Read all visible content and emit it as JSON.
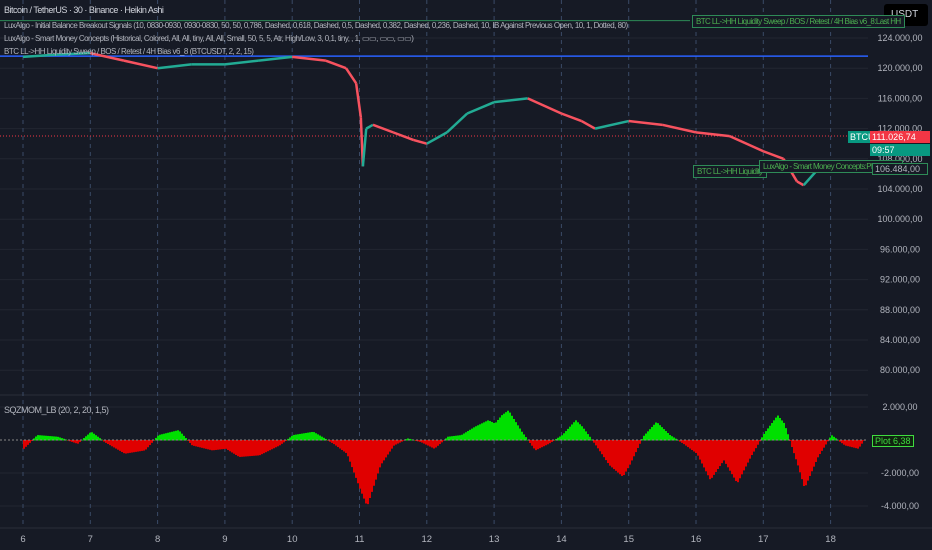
{
  "header": {
    "title": "Bitcoin / TetherUS · 30 · Binance · Heikin Ashi",
    "currency": "USDT"
  },
  "indicators": [
    "LuxAlgo - Initial Balance Breakout Signals (10, 0830-0930, 0930-0830, 50, 50, 0,786, Dashed, 0,618, Dashed, 0,5, Dashed, 0,382, Dashed, 0,236, Dashed, 10, IB Against Previous Open, 10, 1, Dotted, 80)",
    "LuxAlgo - Smart Money Concepts (Historical, Colored, All, All, tiny, All, All, Small, 50, 5, 5, Atr, High/Low, 3, 0,1, tiny, , 1, ▭▭, ▭▭, ▭▭)",
    "BTC LL->HH Liquidity Sweep / BOS / Retest / 4H Bias v6_8 (BTCUSDT, 2, 2, 15)"
  ],
  "oscillator": {
    "label": "SQZMOM_LB (20, 2, 20, 1,5)",
    "plot_label": "Plot",
    "plot_value": "6,38"
  },
  "tags": {
    "last_hh": "BTC LL->HH Liquidity Sweep / BOS / Retest / 4H Bias v6_8:Last HH",
    "ll_hh": "BTC LL->HH Liquidity",
    "plotcandle": "LuxAlgo - Smart Money Concepts:PlotCandle"
  },
  "price_box": {
    "ticker": "BTCU",
    "price": "111.026,74",
    "countdown": "09:57",
    "level": "106.484,00"
  },
  "colors": {
    "up": "#22ab94",
    "down": "#f7525f",
    "hist_up": "#00e000",
    "hist_down": "#e00000",
    "blue": "#2962ff"
  },
  "chart_data": [
    {
      "type": "line",
      "title": "Bitcoin / TetherUS · 30 · Binance · Heikin Ashi",
      "ylim": [
        78000,
        126000
      ],
      "yticks": [
        "124.000,00",
        "120.000,00",
        "116.000,00",
        "112.000,00",
        "108.000,00",
        "104.000,00",
        "100.000,00",
        "96.000,00",
        "92.000,00",
        "88.000,00",
        "84.000,00",
        "80.000,00"
      ],
      "yvals": [
        124000,
        120000,
        116000,
        112000,
        108000,
        104000,
        100000,
        96000,
        92000,
        88000,
        84000,
        80000
      ],
      "xticks": [
        "6",
        "7",
        "8",
        "9",
        "10",
        "11",
        "12",
        "13",
        "14",
        "15",
        "16",
        "17",
        "18"
      ],
      "x": [
        6,
        6.5,
        7,
        7.5,
        8,
        8.5,
        9,
        9.5,
        10,
        10.5,
        10.8,
        10.95,
        11.02,
        11.05,
        11.1,
        11.2,
        11.5,
        11.8,
        12,
        12.3,
        12.6,
        13,
        13.5,
        14,
        14.3,
        14.5,
        15,
        15.5,
        16,
        16.5,
        17,
        17.3,
        17.5,
        17.6,
        17.8,
        18
      ],
      "y": [
        121500,
        121800,
        122000,
        121000,
        120000,
        120500,
        120500,
        121000,
        121500,
        121000,
        120000,
        118000,
        113500,
        107000,
        112000,
        112500,
        111500,
        110500,
        110000,
        111500,
        114000,
        115500,
        116000,
        114000,
        113000,
        112000,
        113000,
        112500,
        111500,
        111000,
        109000,
        108000,
        105000,
        104500,
        106500,
        106500
      ]
    },
    {
      "type": "bar",
      "title": "SQZMOM_LB (20, 2, 20, 1,5)",
      "ylim": [
        -5000,
        3000
      ],
      "yticks": [
        "2.000,00",
        "-2.000,00",
        "-4.000,00"
      ],
      "yvals": [
        2000,
        -2000,
        -4000
      ],
      "x": [
        6.0,
        6.2,
        6.5,
        6.8,
        7.0,
        7.2,
        7.5,
        7.8,
        8.0,
        8.3,
        8.5,
        8.8,
        9.0,
        9.2,
        9.5,
        9.8,
        10,
        10.3,
        10.6,
        10.8,
        11.0,
        11.1,
        11.3,
        11.5,
        11.7,
        11.9,
        12.1,
        12.3,
        12.5,
        12.7,
        12.9,
        13.0,
        13.1,
        13.2,
        13.4,
        13.6,
        13.8,
        14.0,
        14.2,
        14.3,
        14.5,
        14.7,
        14.9,
        15.0,
        15.2,
        15.4,
        15.6,
        15.8,
        16.0,
        16.2,
        16.4,
        16.6,
        16.8,
        17.0,
        17.2,
        17.3,
        17.5,
        17.6,
        17.8,
        18.0,
        18.2,
        18.4,
        18.5
      ],
      "values": [
        -500,
        300,
        200,
        -200,
        500,
        -100,
        -800,
        -600,
        300,
        600,
        -300,
        -600,
        -500,
        -1000,
        -900,
        -300,
        300,
        500,
        -200,
        -800,
        -3000,
        -4000,
        -1500,
        -300,
        100,
        -100,
        -500,
        200,
        300,
        800,
        1200,
        1000,
        1500,
        1800,
        500,
        -600,
        -200,
        300,
        1200,
        800,
        -300,
        -1500,
        -2200,
        -1500,
        200,
        1100,
        300,
        -200,
        -800,
        -2400,
        -1200,
        -2600,
        -1000,
        400,
        1500,
        1000,
        -1500,
        -2900,
        -1000,
        300,
        -300,
        -500,
        100
      ]
    }
  ]
}
